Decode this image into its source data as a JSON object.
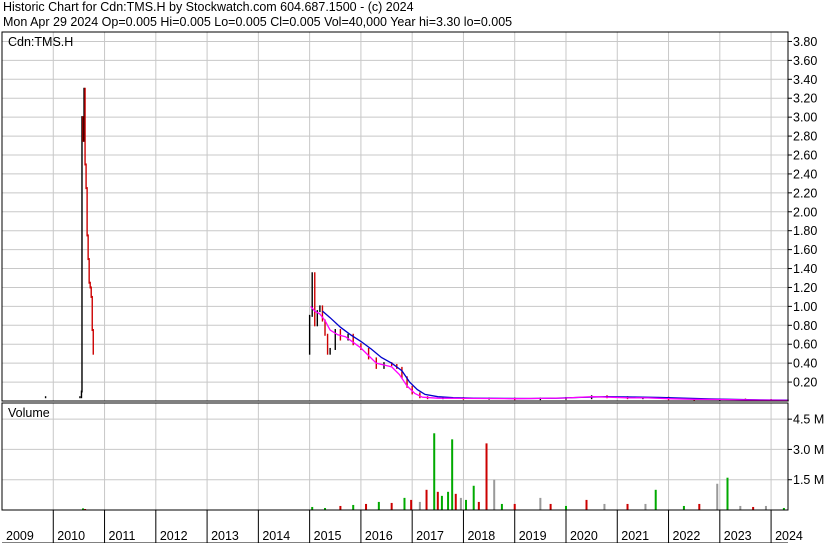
{
  "header": {
    "line1": "Historic Chart for Cdn:TMS.H by Stockwatch.com 604.687.1500 - (c) 2024",
    "line2": "Mon Apr 29 2024   Op=0.005  Hi=0.005  Lo=0.005  Cl=0.005  Vol=40,000  Year hi=3.30  lo=0.005"
  },
  "colors": {
    "ma_fast": "#ff00ff",
    "ma_slow": "#0000cc",
    "price_marks": "#000000",
    "down_marks": "#cc0000",
    "vol_up": "#00aa00",
    "vol_down": "#cc0000",
    "vol_flat": "#999999",
    "grid": "#c8c8c8"
  },
  "chart_data": [
    {
      "type": "line",
      "title": "Cdn:TMS.H",
      "xlabel": "",
      "ylabel": "",
      "grid": true,
      "x_ticks": [
        "2009",
        "2010",
        "2011",
        "2012",
        "2013",
        "2014",
        "2015",
        "2016",
        "2017",
        "2018",
        "2019",
        "2020",
        "2021",
        "2022",
        "2023",
        "2024"
      ],
      "y_ticks": [
        "3.80",
        "3.60",
        "3.40",
        "3.20",
        "3.00",
        "2.80",
        "2.60",
        "2.40",
        "2.20",
        "2.00",
        "1.80",
        "1.60",
        "1.40",
        "1.20",
        "1.00",
        "0.80",
        "0.60",
        "0.40",
        "0.20"
      ],
      "ylim": [
        0,
        3.9
      ],
      "xlim": [
        2009.0,
        2024.33
      ],
      "series": [
        {
          "values": [
            [
              2009.85,
              0.04
            ],
            [
              2010.52,
              0.04
            ],
            [
              2010.55,
              0.1
            ],
            [
              2010.56,
              3.0
            ],
            [
              2010.58,
              2.75
            ],
            [
              2010.6,
              3.3
            ],
            [
              2010.62,
              2.5
            ],
            [
              2010.64,
              2.25
            ],
            [
              2010.66,
              1.75
            ],
            [
              2010.68,
              1.5
            ],
            [
              2010.7,
              1.25
            ],
            [
              2010.72,
              1.2
            ],
            [
              2010.74,
              1.1
            ],
            [
              2010.76,
              0.75
            ],
            [
              2010.78,
              0.5
            ],
            [
              2015.0,
              0.9
            ],
            [
              2015.05,
              1.35
            ],
            [
              2015.1,
              0.8
            ],
            [
              2015.15,
              0.95
            ],
            [
              2015.2,
              1.0
            ],
            [
              2015.25,
              0.85
            ],
            [
              2015.3,
              0.7
            ],
            [
              2015.35,
              0.5
            ],
            [
              2015.4,
              0.55
            ],
            [
              2015.5,
              0.75
            ],
            [
              2015.6,
              0.65
            ],
            [
              2015.75,
              0.7
            ],
            [
              2015.85,
              0.6
            ],
            [
              2016.0,
              0.55
            ],
            [
              2016.15,
              0.45
            ],
            [
              2016.3,
              0.35
            ],
            [
              2016.45,
              0.4
            ],
            [
              2016.6,
              0.38
            ],
            [
              2016.7,
              0.35
            ],
            [
              2016.8,
              0.25
            ],
            [
              2016.9,
              0.15
            ],
            [
              2017.0,
              0.08
            ],
            [
              2017.15,
              0.04
            ],
            [
              2017.3,
              0.03
            ],
            [
              2017.6,
              0.03
            ],
            [
              2018.0,
              0.025
            ],
            [
              2018.5,
              0.025
            ],
            [
              2019.0,
              0.02
            ],
            [
              2019.5,
              0.025
            ],
            [
              2020.0,
              0.03
            ],
            [
              2020.5,
              0.05
            ],
            [
              2020.8,
              0.04
            ],
            [
              2021.2,
              0.03
            ],
            [
              2021.5,
              0.035
            ],
            [
              2022.0,
              0.02
            ],
            [
              2022.5,
              0.015
            ],
            [
              2023.0,
              0.015
            ],
            [
              2023.5,
              0.01
            ],
            [
              2024.0,
              0.005
            ],
            [
              2024.33,
              0.005
            ]
          ]
        },
        {
          "values": [
            [
              2015.02,
              1.0
            ],
            [
              2015.1,
              0.95
            ],
            [
              2015.2,
              0.92
            ],
            [
              2015.3,
              0.85
            ],
            [
              2015.4,
              0.75
            ],
            [
              2015.55,
              0.7
            ],
            [
              2015.7,
              0.68
            ],
            [
              2015.85,
              0.62
            ],
            [
              2016.0,
              0.56
            ],
            [
              2016.15,
              0.48
            ],
            [
              2016.3,
              0.4
            ],
            [
              2016.45,
              0.38
            ],
            [
              2016.6,
              0.36
            ],
            [
              2016.75,
              0.28
            ],
            [
              2016.9,
              0.16
            ],
            [
              2017.05,
              0.08
            ],
            [
              2017.2,
              0.04
            ],
            [
              2017.5,
              0.03
            ],
            [
              2018.0,
              0.028
            ],
            [
              2018.5,
              0.026
            ],
            [
              2019.0,
              0.024
            ],
            [
              2019.5,
              0.027
            ],
            [
              2020.0,
              0.032
            ],
            [
              2020.5,
              0.045
            ],
            [
              2020.85,
              0.04
            ],
            [
              2021.2,
              0.034
            ],
            [
              2021.6,
              0.033
            ],
            [
              2022.0,
              0.024
            ],
            [
              2022.5,
              0.018
            ],
            [
              2023.0,
              0.016
            ],
            [
              2023.5,
              0.012
            ],
            [
              2024.0,
              0.008
            ],
            [
              2024.33,
              0.006
            ]
          ]
        },
        {
          "values": [
            [
              2015.25,
              0.95
            ],
            [
              2015.4,
              0.88
            ],
            [
              2015.6,
              0.78
            ],
            [
              2015.8,
              0.7
            ],
            [
              2016.0,
              0.63
            ],
            [
              2016.2,
              0.55
            ],
            [
              2016.4,
              0.46
            ],
            [
              2016.6,
              0.4
            ],
            [
              2016.8,
              0.32
            ],
            [
              2016.95,
              0.2
            ],
            [
              2017.1,
              0.12
            ],
            [
              2017.25,
              0.07
            ],
            [
              2017.5,
              0.045
            ],
            [
              2017.8,
              0.035
            ],
            [
              2018.2,
              0.03
            ],
            [
              2018.8,
              0.027
            ],
            [
              2019.3,
              0.026
            ],
            [
              2019.8,
              0.03
            ],
            [
              2020.3,
              0.038
            ],
            [
              2020.8,
              0.045
            ],
            [
              2021.3,
              0.042
            ],
            [
              2021.8,
              0.038
            ],
            [
              2022.3,
              0.03
            ],
            [
              2022.8,
              0.022
            ],
            [
              2023.3,
              0.017
            ],
            [
              2023.8,
              0.012
            ],
            [
              2024.33,
              0.009
            ]
          ]
        }
      ]
    },
    {
      "type": "bar",
      "title": "Volume",
      "xlabel": "",
      "ylabel": "",
      "grid": true,
      "y_ticks": [
        "4.5 M",
        "3.0 M",
        "1.5 M"
      ],
      "ylim": [
        0,
        5.3
      ],
      "bars": [
        {
          "x": 2010.58,
          "v": 0.08,
          "c": "up"
        },
        {
          "x": 2010.62,
          "v": 0.05,
          "c": "down"
        },
        {
          "x": 2015.05,
          "v": 0.15,
          "c": "up"
        },
        {
          "x": 2015.3,
          "v": 0.1,
          "c": "up"
        },
        {
          "x": 2015.6,
          "v": 0.2,
          "c": "down"
        },
        {
          "x": 2015.85,
          "v": 0.25,
          "c": "up"
        },
        {
          "x": 2016.1,
          "v": 0.3,
          "c": "down"
        },
        {
          "x": 2016.35,
          "v": 0.4,
          "c": "up"
        },
        {
          "x": 2016.6,
          "v": 0.35,
          "c": "down"
        },
        {
          "x": 2016.85,
          "v": 0.6,
          "c": "up"
        },
        {
          "x": 2016.98,
          "v": 0.5,
          "c": "down"
        },
        {
          "x": 2017.15,
          "v": 0.4,
          "c": "flat"
        },
        {
          "x": 2017.28,
          "v": 1.0,
          "c": "down"
        },
        {
          "x": 2017.43,
          "v": 3.8,
          "c": "up"
        },
        {
          "x": 2017.5,
          "v": 0.9,
          "c": "down"
        },
        {
          "x": 2017.58,
          "v": 0.7,
          "c": "up"
        },
        {
          "x": 2017.7,
          "v": 0.9,
          "c": "up"
        },
        {
          "x": 2017.78,
          "v": 3.5,
          "c": "up"
        },
        {
          "x": 2017.85,
          "v": 0.8,
          "c": "down"
        },
        {
          "x": 2017.95,
          "v": 0.6,
          "c": "flat"
        },
        {
          "x": 2018.05,
          "v": 0.5,
          "c": "up"
        },
        {
          "x": 2018.2,
          "v": 1.2,
          "c": "up"
        },
        {
          "x": 2018.3,
          "v": 0.4,
          "c": "down"
        },
        {
          "x": 2018.45,
          "v": 3.3,
          "c": "down"
        },
        {
          "x": 2018.6,
          "v": 1.5,
          "c": "flat"
        },
        {
          "x": 2018.75,
          "v": 0.3,
          "c": "up"
        },
        {
          "x": 2019.0,
          "v": 0.3,
          "c": "down"
        },
        {
          "x": 2019.5,
          "v": 0.6,
          "c": "flat"
        },
        {
          "x": 2019.7,
          "v": 0.3,
          "c": "down"
        },
        {
          "x": 2020.0,
          "v": 0.2,
          "c": "up"
        },
        {
          "x": 2020.4,
          "v": 0.5,
          "c": "down"
        },
        {
          "x": 2020.75,
          "v": 0.3,
          "c": "flat"
        },
        {
          "x": 2021.2,
          "v": 0.3,
          "c": "down"
        },
        {
          "x": 2021.55,
          "v": 0.3,
          "c": "flat"
        },
        {
          "x": 2021.75,
          "v": 1.0,
          "c": "up"
        },
        {
          "x": 2022.3,
          "v": 0.2,
          "c": "up"
        },
        {
          "x": 2022.6,
          "v": 0.3,
          "c": "down"
        },
        {
          "x": 2022.95,
          "v": 1.3,
          "c": "flat"
        },
        {
          "x": 2023.15,
          "v": 1.6,
          "c": "up"
        },
        {
          "x": 2023.4,
          "v": 0.2,
          "c": "flat"
        },
        {
          "x": 2023.65,
          "v": 0.15,
          "c": "down"
        },
        {
          "x": 2023.9,
          "v": 0.2,
          "c": "flat"
        },
        {
          "x": 2024.25,
          "v": 0.1,
          "c": "up"
        }
      ]
    }
  ]
}
